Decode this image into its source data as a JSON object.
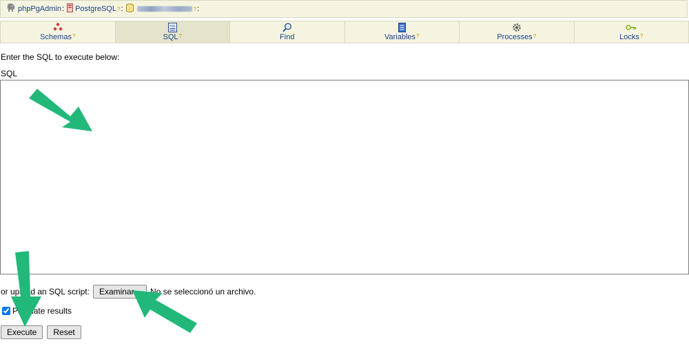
{
  "breadcrumb": {
    "app_label": "phpPgAdmin",
    "server_label": "PostgreSQL",
    "help_mark": "?",
    "separator": ":"
  },
  "tabs": [
    {
      "label": "Schemas",
      "icon": "schemas-icon",
      "active": false
    },
    {
      "label": "SQL",
      "icon": "sql-icon",
      "active": true
    },
    {
      "label": "Find",
      "icon": "find-icon",
      "active": false
    },
    {
      "label": "Variables",
      "icon": "variables-icon",
      "active": false
    },
    {
      "label": "Processes",
      "icon": "processes-icon",
      "active": false
    },
    {
      "label": "Locks",
      "icon": "locks-icon",
      "active": false
    }
  ],
  "main": {
    "intro_text": "Enter the SQL to execute below:",
    "sql_label": "SQL",
    "sql_value": "",
    "upload_prefix": "or upload an SQL script:",
    "file_button_label": "Examinar...",
    "file_status": "No se seleccionó un archivo.",
    "paginate_label": "Paginate results",
    "paginate_checked": true,
    "execute_label": "Execute",
    "reset_label": "Reset"
  },
  "colors": {
    "accent_link": "#1a3f8a",
    "bar_background": "#f4f4e0",
    "active_tab": "#e4e4cc",
    "annotation_arrow": "#21b87a"
  }
}
